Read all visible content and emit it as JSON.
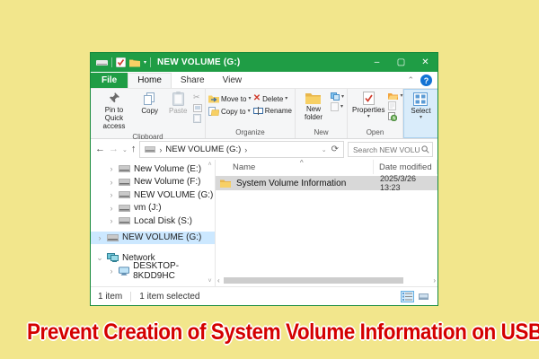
{
  "colors": {
    "titlebar_green": "#1f9d45",
    "background_yellow": "#f2e68c",
    "headline_red": "#d40000",
    "sidebar_selection_blue": "#cce8ff",
    "inactive_row_selection_gray": "#d8d8d8",
    "help_button_blue": "#1273d4"
  },
  "icons": {
    "min": "–",
    "max": "▢",
    "close": "✕",
    "back": "←",
    "forward": "→",
    "up": "↑",
    "dropdown": "⌄",
    "refresh": "⟳",
    "breadcrumb_sep": "›",
    "caret": "▾",
    "cut": "✂",
    "sort_asc": "^",
    "ribbon_collapse": "⌃",
    "help": "?",
    "delete_x": "✕",
    "scroll_up": "˄",
    "scroll_down": "˅",
    "scroll_left": "‹",
    "scroll_right": "›"
  },
  "titlebar": {
    "title": "NEW VOLUME (G:)"
  },
  "tabs": {
    "file": "File",
    "home": "Home",
    "share": "Share",
    "view": "View"
  },
  "ribbon": {
    "clipboard": {
      "pin": "Pin to Quick access",
      "copy": "Copy",
      "paste": "Paste",
      "label": "Clipboard"
    },
    "organize": {
      "move_to": "Move to",
      "copy_to": "Copy to",
      "delete": "Delete",
      "rename": "Rename",
      "label": "Organize"
    },
    "new": {
      "new_folder": "New folder",
      "label": "New"
    },
    "open": {
      "properties": "Properties",
      "label": "Open"
    },
    "select": {
      "select": "Select"
    }
  },
  "addressbar": {
    "breadcrumb": "NEW VOLUME (G:)",
    "search_placeholder": "Search NEW VOLUME..."
  },
  "sidebar": {
    "items": [
      {
        "arrow": "›",
        "icon": "drive",
        "label": "New Volume (E:)"
      },
      {
        "arrow": "›",
        "icon": "drive",
        "label": "New Volume (F:)"
      },
      {
        "arrow": "›",
        "icon": "drive",
        "label": "NEW VOLUME (G:)"
      },
      {
        "arrow": "›",
        "icon": "drive",
        "label": "vm (J:)"
      },
      {
        "arrow": "›",
        "icon": "drive",
        "label": "Local Disk (S:)"
      },
      {
        "arrow": "›",
        "icon": "drive",
        "label": "NEW VOLUME (G:)",
        "selected": true
      },
      {
        "arrow": "⌄",
        "icon": "network",
        "label": "Network"
      },
      {
        "arrow": "›",
        "icon": "computer",
        "label": "DESKTOP-8KDD9HC"
      }
    ]
  },
  "main": {
    "columns": {
      "name": "Name",
      "date": "Date modified"
    },
    "rows": [
      {
        "name": "System Volume Information",
        "date": "2025/3/26 13:23"
      }
    ]
  },
  "statusbar": {
    "items_count": "1 item",
    "selection": "1 item selected"
  },
  "headline": "Prevent Creation of System Volume Information on USB"
}
